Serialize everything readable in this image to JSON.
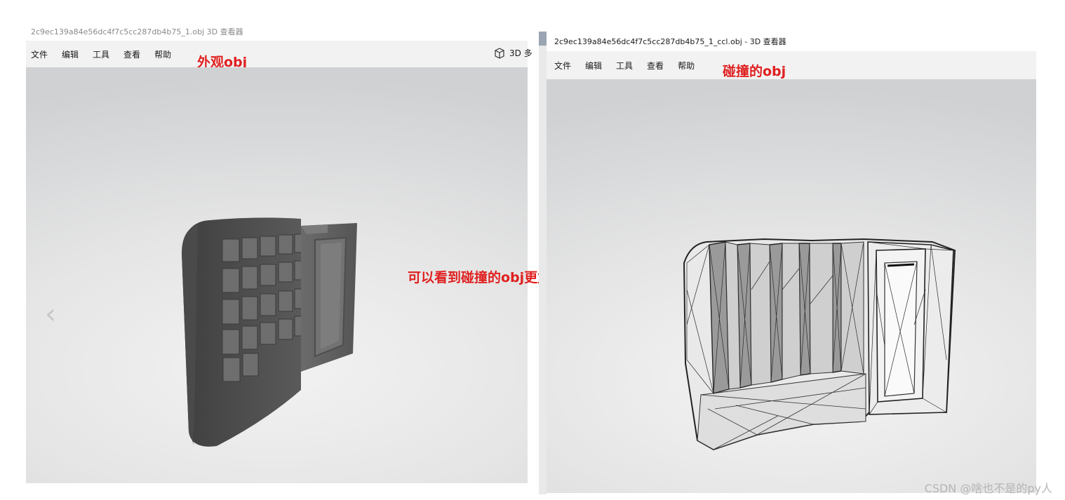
{
  "left_window": {
    "title": "2c9ec139a84e56dc4f7c5cc287db4b75_1.obj   3D 查看器",
    "menu": [
      "文件",
      "编辑",
      "工具",
      "查看",
      "帮助"
    ],
    "annotation": "外观obj",
    "toolbar_partial_label": "3D 多",
    "nav_prev_glyph": "‹"
  },
  "right_window": {
    "title": "2c9ec139a84e56dc4f7c5cc287db4b75_1_ccl.obj - 3D 查看器",
    "menu": [
      "文件",
      "编辑",
      "工具",
      "查看",
      "帮助"
    ],
    "annotation": "碰撞的obj"
  },
  "center_annotation": "可以看到碰撞的obj更复杂",
  "watermark": "CSDN @啥也不是的py人",
  "colors": {
    "annotation": "#e02020",
    "menubar_bg": "#f2f2f2",
    "model_solid": "#5a5a5a",
    "model_wire": "#e8e8e8"
  }
}
